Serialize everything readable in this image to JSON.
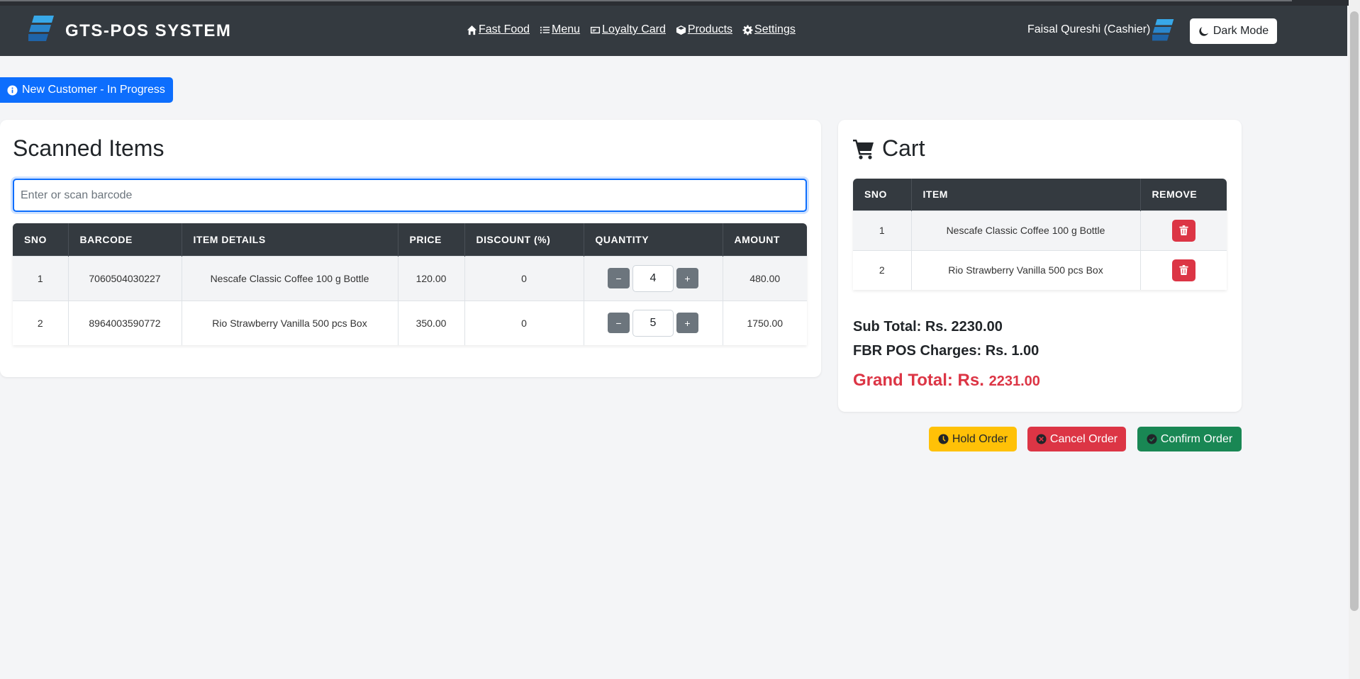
{
  "app": {
    "brand": "GTS-POS SYSTEM"
  },
  "nav": {
    "items": [
      {
        "label": "Fast Food",
        "icon": "home-icon"
      },
      {
        "label": "Menu",
        "icon": "list-icon"
      },
      {
        "label": "Loyalty Card",
        "icon": "card-icon"
      },
      {
        "label": "Products",
        "icon": "box-icon"
      },
      {
        "label": "Settings",
        "icon": "gear-icon"
      }
    ],
    "user": "Faisal Qureshi (Cashier)",
    "dark_mode_label": "Dark Mode"
  },
  "status": {
    "label": "New Customer - In Progress"
  },
  "scanned": {
    "title": "Scanned Items",
    "placeholder": "Enter or scan barcode",
    "headers": [
      "SNO",
      "BARCODE",
      "ITEM DETAILS",
      "PRICE",
      "DISCOUNT (%)",
      "QUANTITY",
      "AMOUNT"
    ],
    "rows": [
      {
        "sno": "1",
        "barcode": "7060504030227",
        "item": "Nescafe Classic Coffee 100 g Bottle",
        "price": "120.00",
        "discount": "0",
        "qty": "4",
        "amount": "480.00"
      },
      {
        "sno": "2",
        "barcode": "8964003590772",
        "item": "Rio Strawberry Vanilla 500 pcs Box",
        "price": "350.00",
        "discount": "0",
        "qty": "5",
        "amount": "1750.00"
      }
    ],
    "minus": "−",
    "plus": "+"
  },
  "cart": {
    "title": "Cart",
    "headers": [
      "SNO",
      "ITEM",
      "REMOVE"
    ],
    "rows": [
      {
        "sno": "1",
        "item": "Nescafe Classic Coffee 100 g Bottle"
      },
      {
        "sno": "2",
        "item": "Rio Strawberry Vanilla 500 pcs Box"
      }
    ],
    "subtotal": "Sub Total: Rs. 2230.00",
    "fbr": "FBR POS Charges: Rs. 1.00",
    "grand_label": "Grand Total: Rs.",
    "grand_amount": "2231.00"
  },
  "actions": {
    "hold": "Hold Order",
    "cancel": "Cancel Order",
    "confirm": "Confirm Order"
  },
  "colors": {
    "navbar": "#343a40",
    "primary": "#0d6efd",
    "danger": "#dc3545",
    "warning": "#ffc107",
    "success": "#198754",
    "secondary": "#6c757d"
  }
}
